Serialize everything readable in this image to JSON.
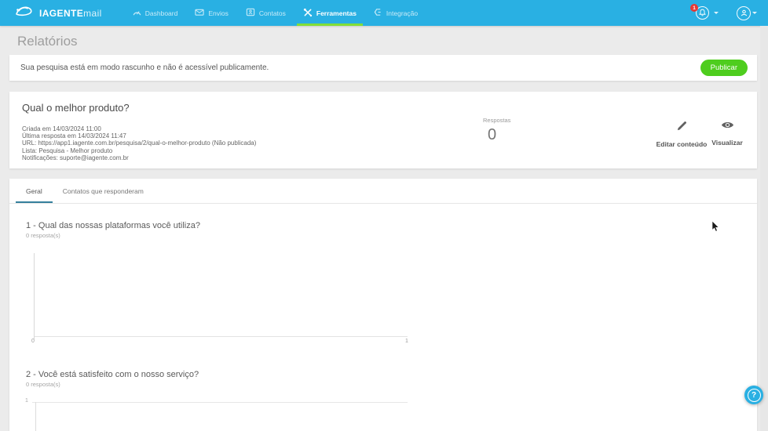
{
  "colors": {
    "topbar_blue": "#29b0e3",
    "accent_green": "#4ecd1e",
    "active_underline_green": "#82de37",
    "badge_red": "#e53935",
    "tab_underline_blue": "#35809d"
  },
  "topbar": {
    "logo_bold": "IAGENTE",
    "logo_light": "mail",
    "nav": [
      {
        "label": "Dashboard",
        "icon": "gauge-icon",
        "active": false
      },
      {
        "label": "Envios",
        "icon": "send-icon",
        "active": false
      },
      {
        "label": "Contatos",
        "icon": "contacts-icon",
        "active": false
      },
      {
        "label": "Ferramentas",
        "icon": "tools-icon",
        "active": true
      },
      {
        "label": "Integração",
        "icon": "plug-icon",
        "active": false
      }
    ],
    "notification_count": "1"
  },
  "page": {
    "title": "Relatórios"
  },
  "draft_notice": {
    "message": "Sua pesquisa está em modo rascunho e não é acessível publicamente.",
    "publish_label": "Publicar"
  },
  "survey": {
    "title": "Qual o melhor produto?",
    "meta": [
      "Criada em 14/03/2024 11:00",
      "Última resposta em 14/03/2024 11:47",
      "URL: https://app1.iagente.com.br/pesquisa/2/qual-o-melhor-produto (Não publicada)",
      "Lista: Pesquisa - Melhor produto",
      "Notificações: suporte@iagente.com.br"
    ],
    "responses_label": "Respostas",
    "responses_count": "0",
    "actions": [
      {
        "label": "Editar conteúdo",
        "icon": "pencil-icon"
      },
      {
        "label": "Visualizar",
        "icon": "eye-icon"
      }
    ]
  },
  "tabs": [
    {
      "label": "Geral",
      "active": true
    },
    {
      "label": "Contatos que responderam",
      "active": false
    }
  ],
  "questions": [
    {
      "title": "1 - Qual das nossas plataformas você utiliza?",
      "responses": "0 resposta(s)"
    },
    {
      "title": "2 - Você está satisfeito com o nosso serviço?",
      "responses": "0 resposta(s)"
    }
  ],
  "chart_data": [
    {
      "type": "bar",
      "orientation": "horizontal",
      "title": "1 - Qual das nossas plataformas você utiliza?",
      "categories": [],
      "values": [],
      "x_ticks": [
        "0",
        "1"
      ],
      "xlim": [
        0,
        1
      ],
      "grid": false,
      "note": "empty chart - 0 responses"
    },
    {
      "type": "bar",
      "orientation": "vertical",
      "title": "2 - Você está satisfeito com o nosso serviço?",
      "categories": [],
      "values": [],
      "y_ticks": [
        "1"
      ],
      "grid": true,
      "note": "empty chart - 0 responses - partially visible at bottom of viewport"
    }
  ],
  "help": {
    "label": "?"
  }
}
